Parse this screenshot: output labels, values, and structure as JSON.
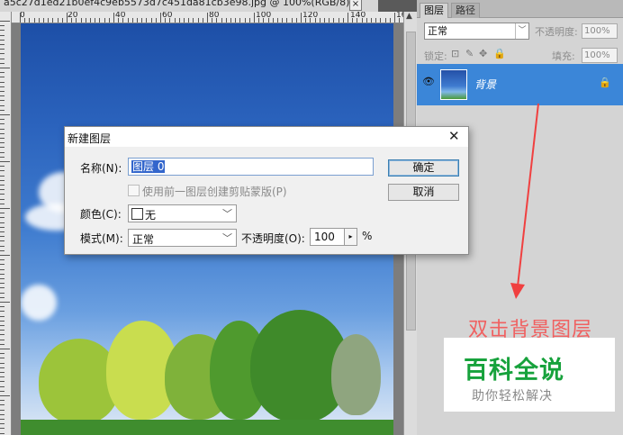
{
  "document": {
    "tab_title": "a5c27d1ed21b0ef4c9eb5573d7c451da81cb3e98.jpg @ 100%(RGB/8) *",
    "close_glyph": "×"
  },
  "ruler": {
    "labels": [
      "0",
      "20",
      "40",
      "60",
      "80",
      "100",
      "120",
      "140",
      "16"
    ]
  },
  "layers_panel": {
    "tabs": [
      "图层",
      "路径"
    ],
    "blend_mode": "正常",
    "opacity_label": "不透明度:",
    "opacity_value": "100%",
    "lock_label": "锁定:",
    "fill_label": "填充:",
    "fill_value": "100%",
    "layer_name": "背景",
    "icons": [
      "eye-icon",
      "lock-icon",
      "brush-icon",
      "move-icon"
    ]
  },
  "annotation": {
    "text": "双击背景图层",
    "color": "#f06060"
  },
  "watermark": {
    "title": "百科全说",
    "subtitle": "助你轻松解决",
    "color": "#17a23c"
  },
  "dialog": {
    "title": "新建图层",
    "close_glyph": "✕",
    "name_label": "名称(N):",
    "name_value": "图层 0",
    "clip_label": "使用前一图层创建剪贴蒙版(P)",
    "color_label": "颜色(C):",
    "color_value": "无",
    "mode_label": "模式(M):",
    "mode_value": "正常",
    "opacity_label": "不透明度(O):",
    "opacity_value": "100",
    "opacity_unit": "%",
    "ok_label": "确定",
    "cancel_label": "取消"
  }
}
